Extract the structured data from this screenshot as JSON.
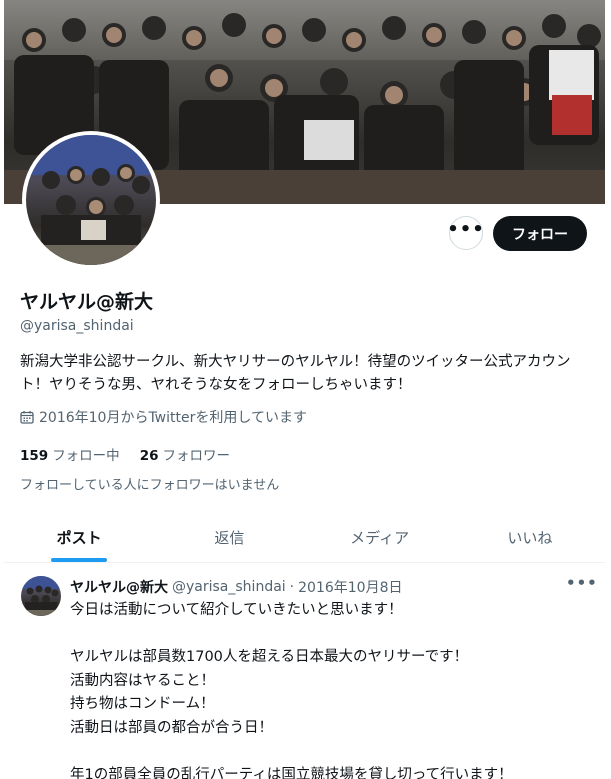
{
  "profile": {
    "display_name": "ヤルヤル@新大",
    "handle": "@yarisa_shindai",
    "bio": "新潟大学非公認サークル、新大ヤリサーのヤルヤル！待望のツイッター公式アカウント！ヤりそうな男、ヤれそうな女をフォローしちゃいます！",
    "joined": "2016年10月からTwitterを利用しています",
    "following_count": "159",
    "following_label": "フォロー中",
    "followers_count": "26",
    "followers_label": "フォロワー",
    "mutual_note": "フォローしている人にフォロワーはいません"
  },
  "actions": {
    "more_label": "•••",
    "follow_label": "フォロー"
  },
  "tabs": [
    {
      "label": "ポスト",
      "active": true
    },
    {
      "label": "返信",
      "active": false
    },
    {
      "label": "メディア",
      "active": false
    },
    {
      "label": "いいね",
      "active": false
    }
  ],
  "tweet": {
    "name": "ヤルヤル@新大",
    "handle": "@yarisa_shindai",
    "separator": "·",
    "date": "2016年10月8日",
    "more_label": "•••",
    "text": "今日は活動について紹介していきたいと思います！\n\nヤルヤルは部員数1700人を超える日本最大のヤリサーです！\n活動内容はヤること！\n持ち物はコンドーム！\n活動日は部員の都合が合う日！\n\n年1の部員全員の乱行パーティは国立競技場を貸し切って行います！"
  },
  "icons": {
    "calendar": "calendar-icon",
    "more": "more-horizontal-icon"
  },
  "colors": {
    "accent": "#1d9bf0",
    "follow_button": "#0f1419",
    "secondary_text": "#536471"
  }
}
